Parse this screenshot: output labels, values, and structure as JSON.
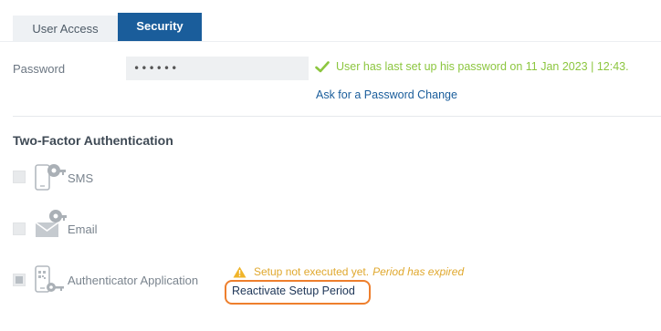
{
  "tabs": [
    {
      "label": "User Access",
      "active": false
    },
    {
      "label": "Security",
      "active": true
    }
  ],
  "password": {
    "label": "Password",
    "value": "••••••",
    "status": "User has last set up his password on 11 Jan 2023 | 12:43.",
    "change_link": "Ask for a Password Change"
  },
  "tfa": {
    "title": "Two-Factor Authentication",
    "options": [
      {
        "label": "SMS",
        "icon": "phone-key-icon",
        "checked": false
      },
      {
        "label": "Email",
        "icon": "envelope-key-icon",
        "checked": false
      },
      {
        "label": "Authenticator Application",
        "icon": "phone-qr-key-icon",
        "checked": true
      }
    ],
    "warning_text": "Setup not executed yet.",
    "warning_emphasis": "Period has expired",
    "reactivate_link": "Reactivate Setup Period"
  },
  "colors": {
    "primary": "#1a5d9b",
    "success": "#8cc63f",
    "warning": "#e0a82e",
    "highlight": "#ee7f2d"
  }
}
